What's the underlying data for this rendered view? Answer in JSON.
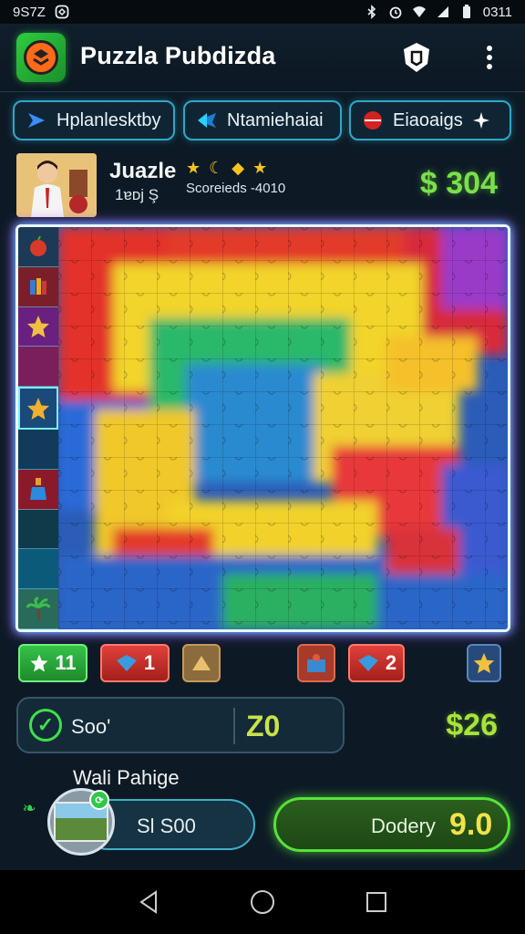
{
  "status_bar": {
    "time": "9S7Z",
    "battery_text": "0311",
    "icons": [
      "notification-icon",
      "bluetooth-icon",
      "alarm-icon",
      "wifi-icon",
      "signal-icon",
      "battery-icon"
    ]
  },
  "header": {
    "title": "Puzzla Pubdizda",
    "logo_icon": "app-logo-icon",
    "shield_icon": "shield-icon",
    "more_icon": "more-vert-icon"
  },
  "filters": [
    {
      "label": "Hplanlesktby",
      "icon": "arrow-flag-icon"
    },
    {
      "label": "Ntamiehaiai",
      "icon": "bird-icon"
    },
    {
      "label": "Eiaoaigs",
      "icon": "ball-icon"
    }
  ],
  "player": {
    "name": "Juazle",
    "stars": "★ ☾ ◆ ★",
    "sub": "1ɐᴅj Ş",
    "score_label": "Scoreieds -4010",
    "money": "$ 304"
  },
  "board": {
    "side_icons": [
      "apple-icon",
      "books-icon",
      "star-icon",
      "blank",
      "star-icon",
      "blank",
      "potion-icon",
      "blank",
      "ocean-icon",
      "palm-tree-icon"
    ]
  },
  "powerups": {
    "green_value": "11",
    "red_value": "1",
    "red2_value": "2"
  },
  "score": {
    "label": "Soo'",
    "value": "Z0",
    "side_money": "$26"
  },
  "wall": {
    "label": "Wali Pahige",
    "pill_text": "Sl S00"
  },
  "deploy": {
    "label": "Dodery",
    "value": "9.0"
  },
  "colors": {
    "accent_green": "#58e13a",
    "money_green": "#79e04a",
    "chip_border": "#2fa6c8",
    "background": "#0d1a26"
  }
}
